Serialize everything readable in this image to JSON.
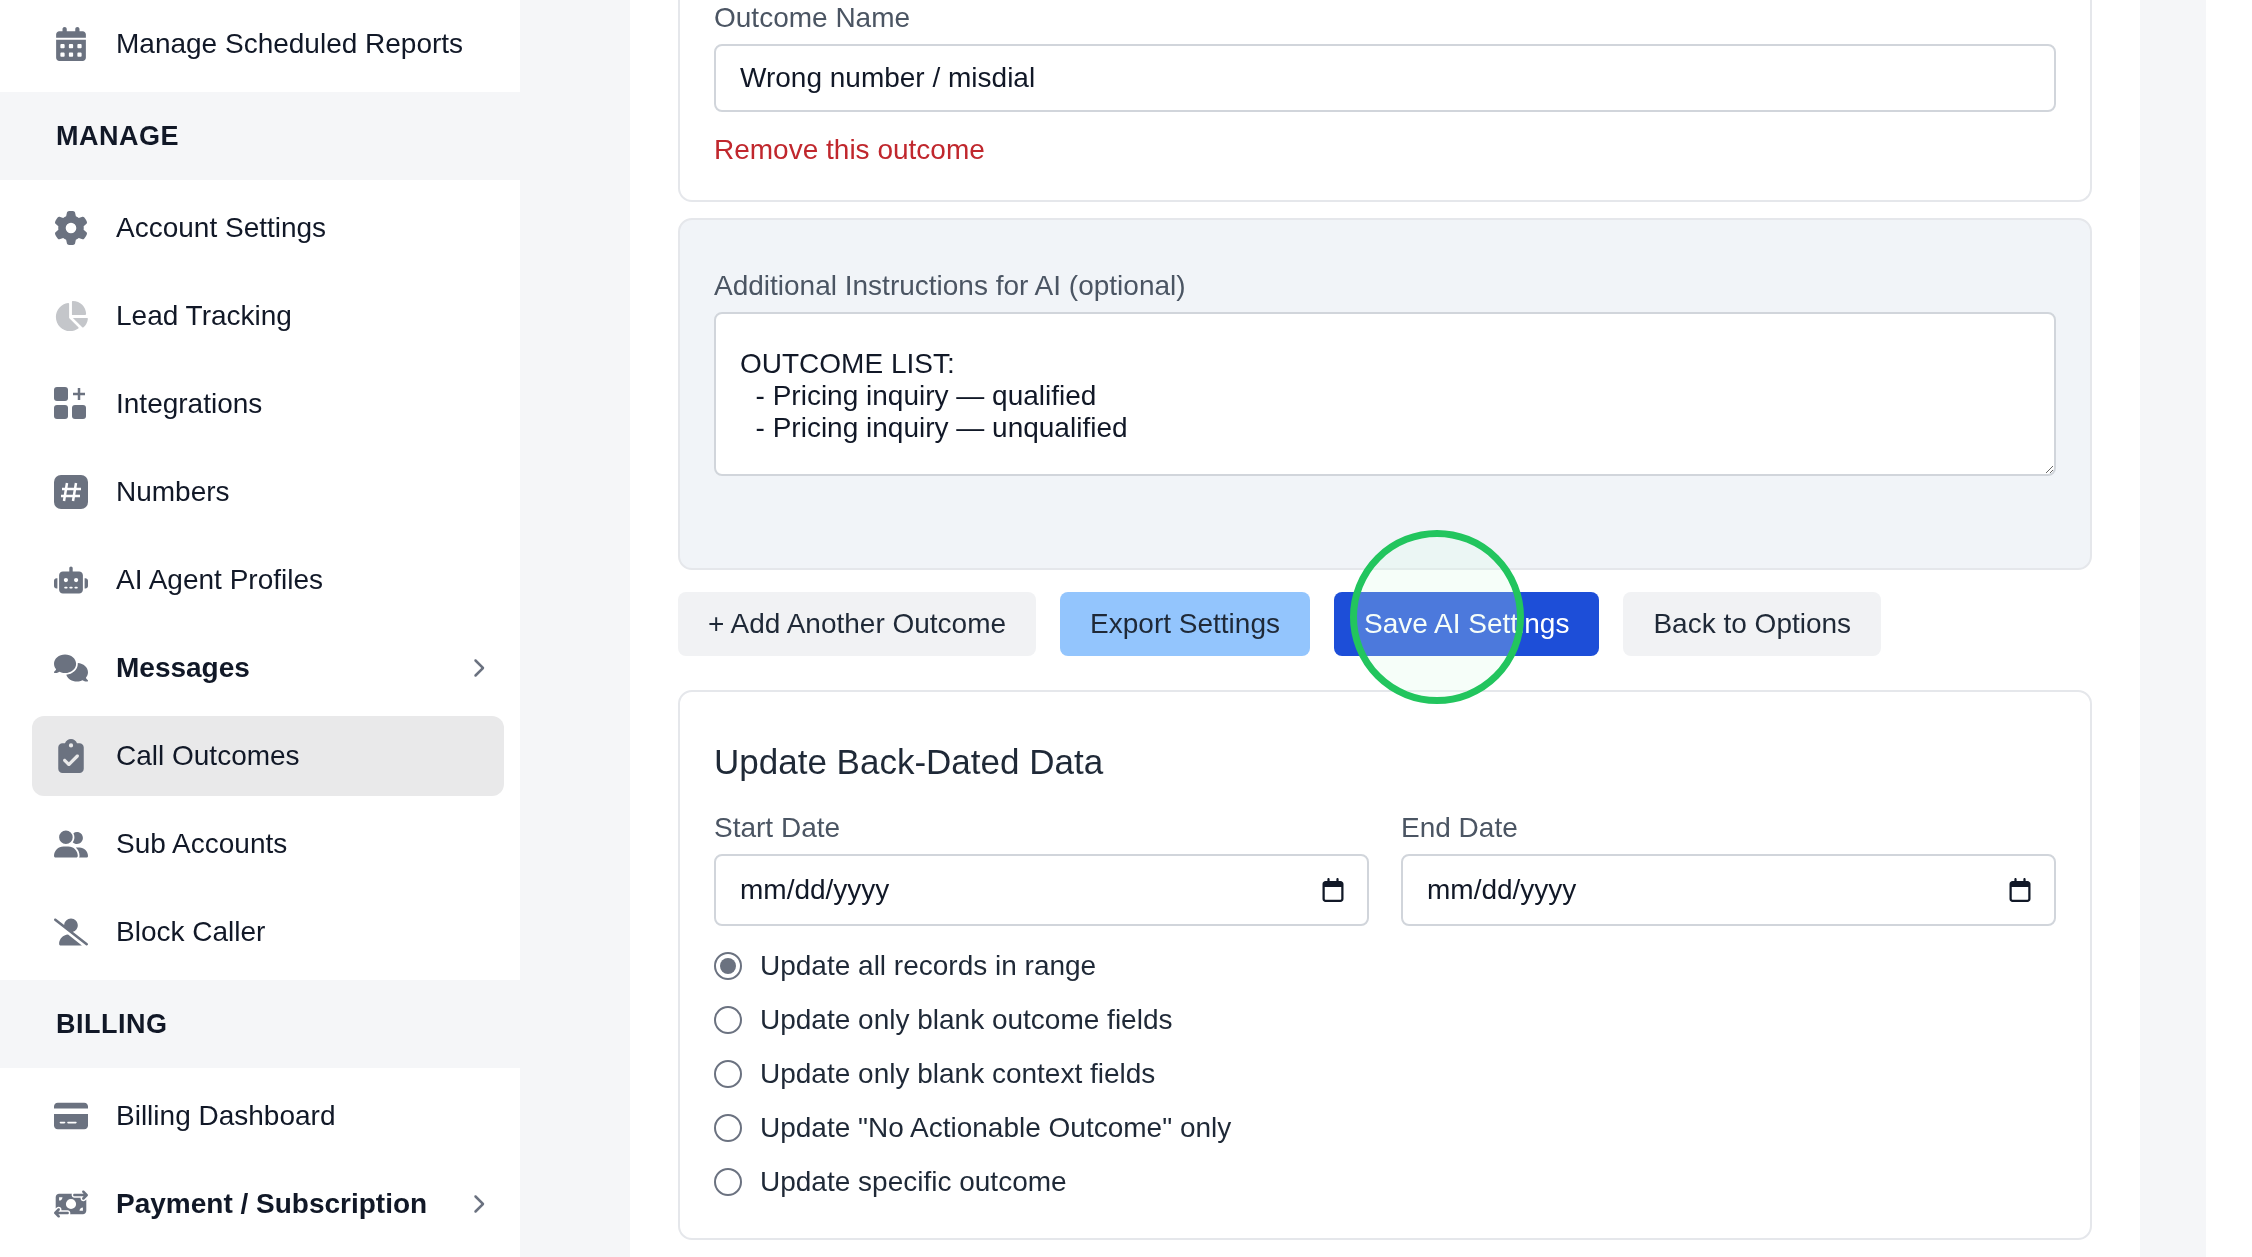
{
  "sidebar": {
    "top_items": [
      {
        "label": "Manage Scheduled Reports",
        "bold": false,
        "has_submenu": false,
        "selected": false
      }
    ],
    "sections": [
      {
        "title": "MANAGE",
        "items": [
          {
            "label": "Account Settings",
            "bold": false,
            "has_submenu": false,
            "selected": false
          },
          {
            "label": "Lead Tracking",
            "bold": false,
            "has_submenu": false,
            "selected": false
          },
          {
            "label": "Integrations",
            "bold": false,
            "has_submenu": false,
            "selected": false
          },
          {
            "label": "Numbers",
            "bold": false,
            "has_submenu": false,
            "selected": false
          },
          {
            "label": "AI Agent Profiles",
            "bold": false,
            "has_submenu": false,
            "selected": false
          },
          {
            "label": "Messages",
            "bold": true,
            "has_submenu": true,
            "selected": false
          },
          {
            "label": "Call Outcomes",
            "bold": false,
            "has_submenu": false,
            "selected": true
          },
          {
            "label": "Sub Accounts",
            "bold": false,
            "has_submenu": false,
            "selected": false
          },
          {
            "label": "Block Caller",
            "bold": false,
            "has_submenu": false,
            "selected": false
          }
        ]
      },
      {
        "title": "BILLING",
        "items": [
          {
            "label": "Billing Dashboard",
            "bold": false,
            "has_submenu": false,
            "selected": false
          },
          {
            "label": "Payment / Subscription",
            "bold": true,
            "has_submenu": true,
            "selected": false
          }
        ]
      }
    ]
  },
  "outcome": {
    "label": "Outcome Name",
    "value": "Wrong number / misdial",
    "remove_link": "Remove this outcome"
  },
  "instructions": {
    "label": "Additional Instructions for AI (optional)",
    "lines": [
      "OUTCOME LIST:",
      "  - Pricing inquiry — qualified",
      "  - Pricing inquiry — unqualified"
    ]
  },
  "actions": [
    {
      "label": "+ Add Another Outcome",
      "kind": "secondary"
    },
    {
      "label": "Export Settings",
      "kind": "light"
    },
    {
      "label": "Save AI Settings",
      "kind": "primary"
    },
    {
      "label": "Back to Options",
      "kind": "secondary"
    }
  ],
  "backdated": {
    "title": "Update Back-Dated Data",
    "date_fields": [
      {
        "label": "Start Date",
        "placeholder": "mm/dd/yyyy"
      },
      {
        "label": "End Date",
        "placeholder": "mm/dd/yyyy"
      }
    ],
    "options": [
      {
        "label": "Update all records in range",
        "selected": true
      },
      {
        "label": "Update only blank outcome fields",
        "selected": false
      },
      {
        "label": "Update only blank context fields",
        "selected": false
      },
      {
        "label": "Update \"No Actionable Outcome\" only",
        "selected": false
      },
      {
        "label": "Update specific outcome",
        "selected": false
      }
    ]
  }
}
